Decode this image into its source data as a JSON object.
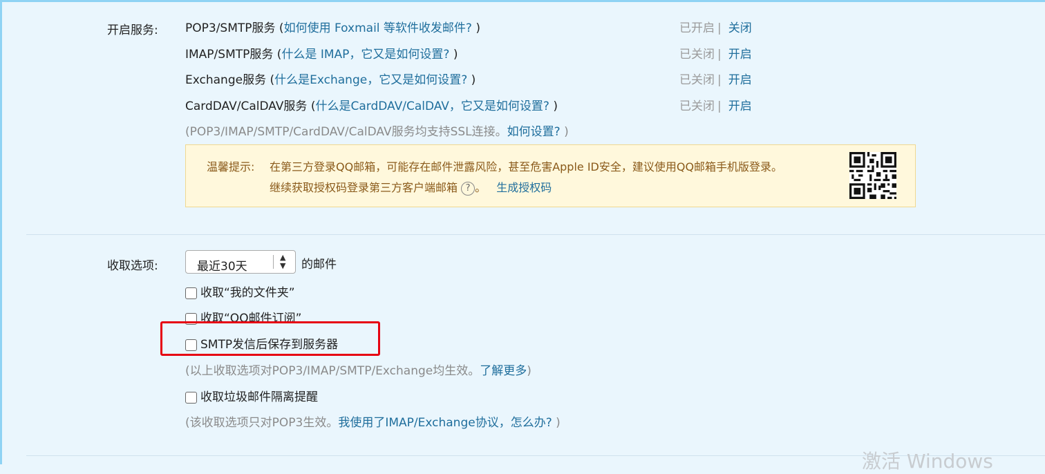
{
  "services": {
    "label": "开启服务:",
    "rows": [
      {
        "name": "POP3/SMTP服务",
        "open_paren": " (",
        "help": "如何使用 Foxmail 等软件收发邮件?",
        "close_paren": " )",
        "status": "已开启",
        "sep": "|",
        "action": "关闭"
      },
      {
        "name": "IMAP/SMTP服务",
        "open_paren": " (",
        "help": "什么是 IMAP，它又是如何设置?",
        "close_paren": " )",
        "status": "已关闭",
        "sep": "|",
        "action": "开启"
      },
      {
        "name": "Exchange服务",
        "open_paren": " (",
        "help": "什么是Exchange，它又是如何设置?",
        "close_paren": " )",
        "status": "已关闭",
        "sep": "|",
        "action": "开启"
      },
      {
        "name": "CardDAV/CalDAV服务",
        "open_paren": " (",
        "help": "什么是CardDAV/CalDAV，它又是如何设置?",
        "close_paren": " )",
        "status": "已关闭",
        "sep": "|",
        "action": "开启"
      }
    ],
    "ssl_note": "(POP3/IMAP/SMTP/CardDAV/CalDAV服务均支持SSL连接。",
    "ssl_link": "如何设置?",
    "ssl_close": " )"
  },
  "tip": {
    "title": "温馨提示:",
    "line1": "在第三方登录QQ邮箱，可能存在邮件泄露风险，甚至危害Apple ID安全，建议使用QQ邮箱手机版登录。",
    "line2": "继续获取授权码登录第三方客户端邮箱",
    "help_glyph": "?",
    "dot": "。",
    "link": "生成授权码"
  },
  "receive": {
    "label": "收取选项:",
    "select_value": "最近30天",
    "select_suffix": "的邮件",
    "options": [
      "收取“我的文件夹”",
      "收取“QQ邮件订阅”",
      "SMTP发信后保存到服务器"
    ],
    "note1": "(以上收取选项对POP3/IMAP/SMTP/Exchange均生效。",
    "note1_link": "了解更多",
    "note1_close": ")",
    "junk_option": "收取垃圾邮件隔离提醒",
    "note2": "(该收取选项只对POP3生效。",
    "note2_link": "我使用了IMAP/Exchange协议，怎么办?",
    "note2_close": " )"
  },
  "watermark": "激活 Windows",
  "colors": {
    "link": "#1f6e9c",
    "highlight_box": "#e60012",
    "background": "#eaf6fd",
    "tip_bg": "#fff8dc"
  }
}
